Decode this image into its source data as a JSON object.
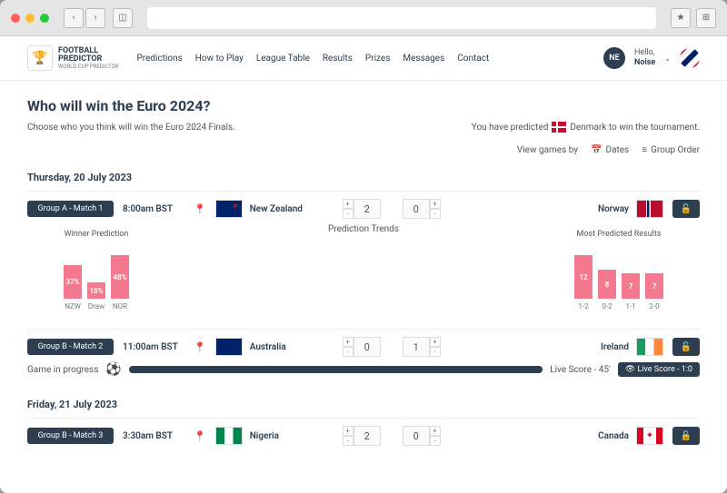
{
  "logo": {
    "line1": "FOOTBALL",
    "line2": "PREDICTOR",
    "sub": "WORLD CUP PREDICTOR"
  },
  "nav": [
    "Predictions",
    "How to Play",
    "League Table",
    "Results",
    "Prizes",
    "Messages",
    "Contact"
  ],
  "user": {
    "hello": "Hello,",
    "name": "Noise",
    "initials": "NE"
  },
  "page": {
    "title": "Who will win the Euro 2024?",
    "subtitle": "Choose who you think will win the Euro 2024 Finals.",
    "predicted_prefix": "You have predicted",
    "predicted_suffix": "Denmark to win the tournament.",
    "view_label": "View games by",
    "view_dates": "Dates",
    "view_group": "Group Order"
  },
  "dates": [
    "Thursday, 20 July 2023",
    "Friday, 21 July 2023"
  ],
  "matches": [
    {
      "tag": "Group A - Match 1",
      "time": "8:00am BST",
      "home": "New Zealand",
      "away": "Norway",
      "hs": "2",
      "as": "0"
    },
    {
      "tag": "Group B - Match 2",
      "time": "11:00am BST",
      "home": "Australia",
      "away": "Ireland",
      "hs": "0",
      "as": "1"
    },
    {
      "tag": "Group B - Match 3",
      "time": "3:30am BST",
      "home": "Nigeria",
      "away": "Canada",
      "hs": "2",
      "as": "0"
    }
  ],
  "trends": {
    "title": "Prediction Trends",
    "winner_title": "Winner Prediction",
    "results_title": "Most Predicted Results"
  },
  "progress": {
    "label": "Game in progress",
    "live_time": "Live Score - 45'",
    "live_score": "Live Score - 1:0"
  },
  "chart_data": [
    {
      "type": "bar",
      "title": "Winner Prediction",
      "categories": [
        "NZW",
        "Draw",
        "NOR"
      ],
      "values": [
        37,
        18,
        48
      ],
      "value_suffix": "%",
      "ylim": [
        0,
        60
      ]
    },
    {
      "type": "bar",
      "title": "Most Predicted Results",
      "categories": [
        "1-2",
        "0-2",
        "1-1",
        "2-0"
      ],
      "values": [
        12,
        8,
        7,
        7
      ],
      "ylim": [
        0,
        15
      ]
    }
  ]
}
